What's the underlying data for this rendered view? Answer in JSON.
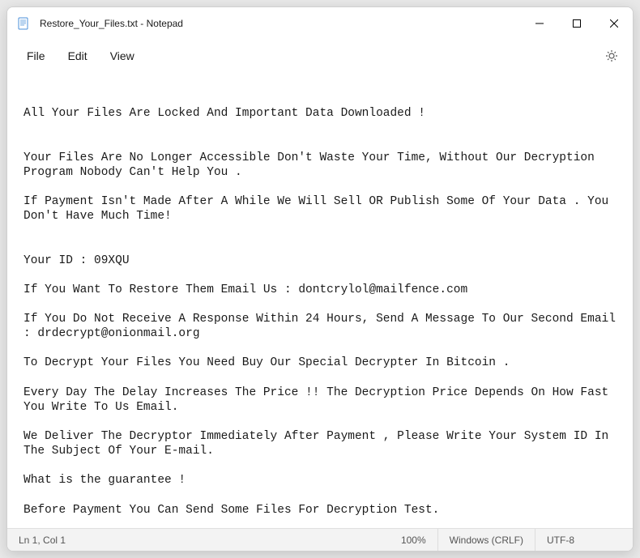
{
  "titlebar": {
    "title": "Restore_Your_Files.txt - Notepad"
  },
  "menubar": {
    "file": "File",
    "edit": "Edit",
    "view": "View"
  },
  "content": "All Your Files Are Locked And Important Data Downloaded !\n\n\nYour Files Are No Longer Accessible Don't Waste Your Time, Without Our Decryption Program Nobody Can't Help You .\n\nIf Payment Isn't Made After A While We Will Sell OR Publish Some Of Your Data . You Don't Have Much Time!\n\n\nYour ID : 09XQU\n\nIf You Want To Restore Them Email Us : dontcrylol@mailfence.com\n\nIf You Do Not Receive A Response Within 24 Hours, Send A Message To Our Second Email : drdecrypt@onionmail.org\n\nTo Decrypt Your Files You Need Buy Our Special Decrypter In Bitcoin .\n\nEvery Day The Delay Increases The Price !! The Decryption Price Depends On How Fast You Write To Us Email.\n\nWe Deliver The Decryptor Immediately After Payment , Please Write Your System ID In The Subject Of Your E-mail.\n\nWhat is the guarantee !\n\nBefore Payment You Can Send Some Files For Decryption Test.\n\nIf We Do Not Fulfill Our Obligations, No One Does Business With Us , Our Reputation Is Important To Us",
  "statusbar": {
    "position": "Ln 1, Col 1",
    "zoom": "100%",
    "line_ending": "Windows (CRLF)",
    "encoding": "UTF-8"
  }
}
